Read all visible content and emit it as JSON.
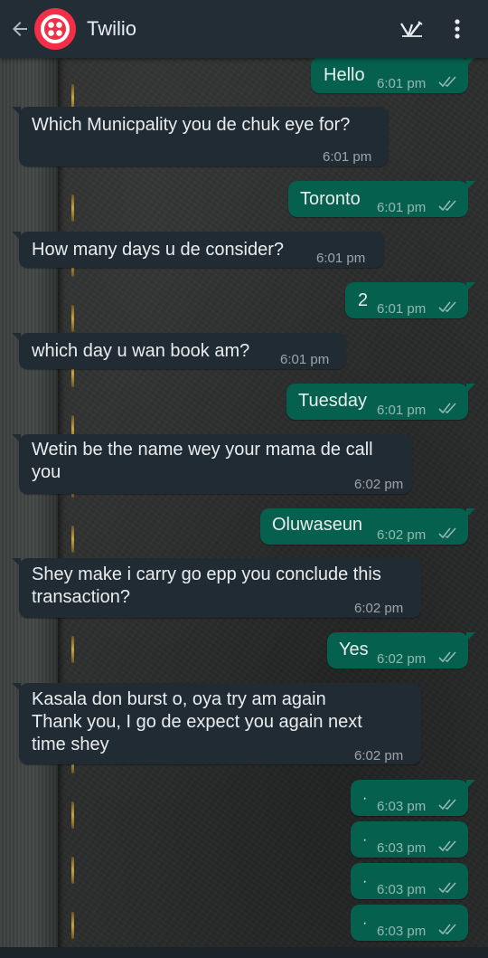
{
  "header": {
    "title": "Twilio",
    "back_icon": "arrow-left-icon",
    "avatar_icon": "twilio-logo-icon",
    "actions": [
      "video-pen-icon",
      "more-vert-icon"
    ]
  },
  "colors": {
    "header_bg": "#232d36",
    "incoming_bubble": "#212b33",
    "outgoing_bubble": "#05604e",
    "brand_red": "#f22f46"
  },
  "messages": [
    {
      "dir": "out",
      "text": "Hello",
      "time": "6:01 pm"
    },
    {
      "dir": "in",
      "text": "Which Municpality you de chuk eye for?",
      "time": "6:01 pm"
    },
    {
      "dir": "out",
      "text": "Toronto",
      "time": "6:01 pm"
    },
    {
      "dir": "in",
      "text": "How many days u de consider?",
      "time": "6:01 pm"
    },
    {
      "dir": "out",
      "text": "2",
      "time": "6:01 pm"
    },
    {
      "dir": "in",
      "text": "which day u wan book am?",
      "time": "6:01 pm"
    },
    {
      "dir": "out",
      "text": "Tuesday",
      "time": "6:01 pm"
    },
    {
      "dir": "in",
      "text": "Wetin be the name wey your mama de call\nyou",
      "time": "6:02 pm"
    },
    {
      "dir": "out",
      "text": "Oluwaseun",
      "time": "6:02 pm"
    },
    {
      "dir": "in",
      "text": "Shey make i carry go epp you conclude this\ntransaction?",
      "time": "6:02 pm"
    },
    {
      "dir": "out",
      "text": "Yes",
      "time": "6:02 pm"
    },
    {
      "dir": "in",
      "text": "Kasala don burst o, oya try am again\nThank you, I go de expect you again next\ntime shey",
      "time": "6:02 pm"
    },
    {
      "dir": "out",
      "text": "·",
      "time": "6:03 pm"
    },
    {
      "dir": "out",
      "text": "·",
      "time": "6:03 pm"
    },
    {
      "dir": "out",
      "text": "·",
      "time": "6:03 pm"
    },
    {
      "dir": "out",
      "text": "·",
      "time": "6:03 pm"
    }
  ]
}
